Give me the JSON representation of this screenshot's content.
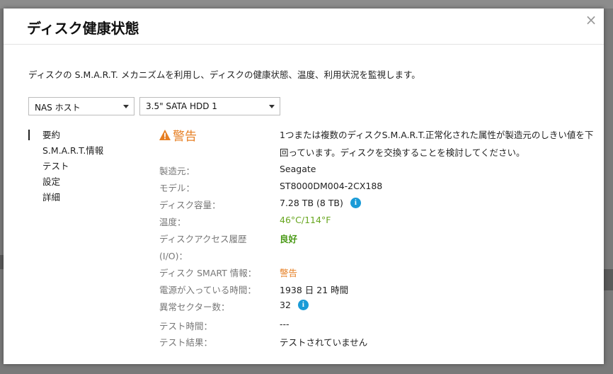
{
  "dialog": {
    "title": "ディスク健康状態",
    "close_glyph": "×",
    "description": "ディスクの S.M.A.R.T. メカニズムを利用し、ディスクの健康状態、温度、利用状況を監視します。"
  },
  "selectors": {
    "host": "NAS ホスト",
    "disk": "3.5\" SATA HDD 1"
  },
  "nav": {
    "items": [
      "要約",
      "S.M.A.R.T.情報",
      "テスト",
      "設定",
      "詳細"
    ],
    "active": "要約"
  },
  "summary": {
    "status_title": "警告",
    "status_message": "1つまたは複数のディスクS.M.A.R.T.正常化された属性が製造元のしきい値を下回っています。ディスクを交換することを検討してください。",
    "fields": {
      "manufacturer_label": "製造元：",
      "manufacturer_value": "Seagate",
      "model_label": "モデル：",
      "model_value": "ST8000DM004-2CX188",
      "capacity_label": "ディスク容量：",
      "capacity_value": "7.28 TB (8 TB)",
      "temperature_label": "温度：",
      "temperature_value": "46°C/114°F",
      "access_label_line1": "ディスクアクセス履歴",
      "access_label_line2": "(I/O)：",
      "access_value": "良好",
      "smart_label": "ディスク SMART 情報：",
      "smart_value": "警告",
      "power_on_label": "電源が入っている時間：",
      "power_on_value": "1938 日 21 時間",
      "bad_sectors_label": "異常セクター数：",
      "bad_sectors_value": "32",
      "test_time_label": "テスト時間：",
      "test_time_value": "---",
      "test_result_label": "テスト結果：",
      "test_result_value": "テストされていません"
    }
  },
  "colors": {
    "warning": "#e67e22",
    "good": "#4a9a17",
    "temperature": "#67a61f",
    "info": "#1a9bd7"
  },
  "icons": [
    "warning-triangle-icon",
    "info-icon",
    "close-icon",
    "chevron-down-icon"
  ]
}
